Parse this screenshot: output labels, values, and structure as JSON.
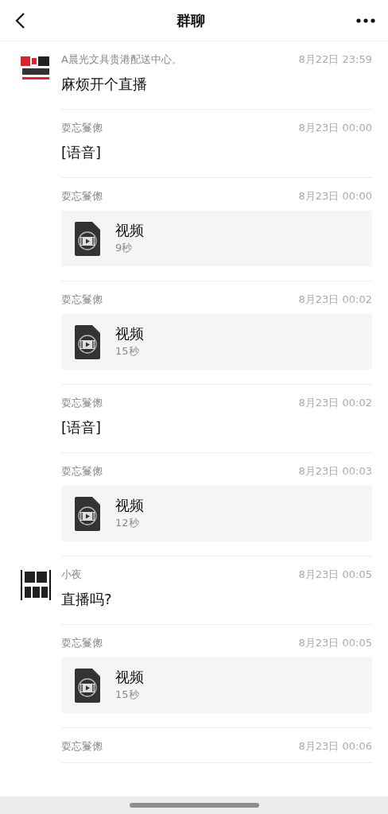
{
  "header": {
    "title": "群聊"
  },
  "messages": [
    {
      "sender": "A晨光文具贵港配送中心。",
      "time": "8月22日 23:59",
      "has_avatar": true,
      "kind": "text",
      "text": "麻烦开个直播"
    },
    {
      "sender": "耍忘鬘偬",
      "time": "8月23日 00:00",
      "has_avatar": false,
      "kind": "text",
      "text": "[语音]"
    },
    {
      "sender": "耍忘鬘偬",
      "time": "8月23日 00:00",
      "has_avatar": false,
      "kind": "video",
      "title": "视频",
      "duration": "9秒"
    },
    {
      "sender": "耍忘鬘偬",
      "time": "8月23日 00:02",
      "has_avatar": false,
      "kind": "video",
      "title": "视频",
      "duration": "15秒"
    },
    {
      "sender": "耍忘鬘偬",
      "time": "8月23日 00:02",
      "has_avatar": false,
      "kind": "text",
      "text": "[语音]"
    },
    {
      "sender": "耍忘鬘偬",
      "time": "8月23日 00:03",
      "has_avatar": false,
      "kind": "video",
      "title": "视频",
      "duration": "12秒"
    },
    {
      "sender": "小夜",
      "time": "8月23日 00:05",
      "has_avatar": true,
      "kind": "text",
      "text": "直播吗?"
    },
    {
      "sender": "耍忘鬘偬",
      "time": "8月23日 00:05",
      "has_avatar": false,
      "kind": "video",
      "title": "视频",
      "duration": "15秒"
    },
    {
      "sender": "耍忘鬘偬",
      "time": "8月23日 00:06",
      "has_avatar": false,
      "kind": "partial"
    }
  ]
}
